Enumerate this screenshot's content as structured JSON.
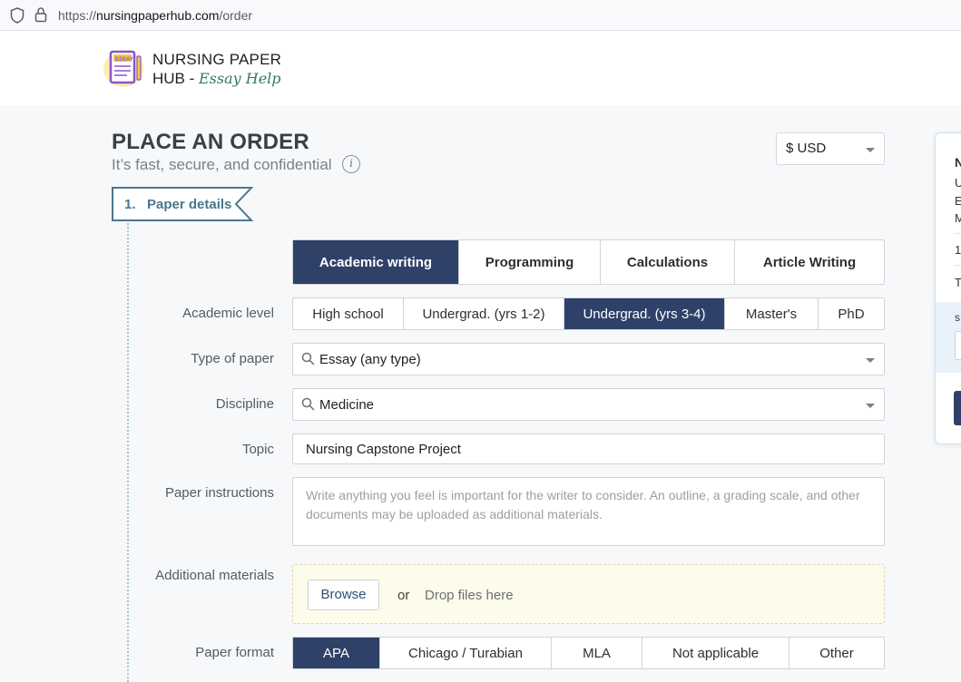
{
  "browser": {
    "url_prefix": "https://",
    "url_host": "nursingpaperhub.com",
    "url_path": "/order"
  },
  "brand": {
    "line1": "NURSING PAPER",
    "line2_prefix": "HUB - ",
    "line2_script": "Essay Help",
    "logo_text": "ESSAY"
  },
  "page": {
    "title": "PLACE AN ORDER",
    "subtitle": "It’s fast, secure, and confidential",
    "info_glyph": "i"
  },
  "currency": {
    "value": "$ USD"
  },
  "step": {
    "label": "1.   Paper details"
  },
  "side_panel": {
    "lines": [
      "N",
      "U",
      "E",
      "M",
      "1",
      "T",
      "s"
    ]
  },
  "service_tabs": [
    {
      "label": "Academic writing",
      "active": true
    },
    {
      "label": "Programming",
      "active": false
    },
    {
      "label": "Calculations",
      "active": false
    },
    {
      "label": "Article Writing",
      "active": false
    }
  ],
  "academic_level": {
    "label": "Academic level",
    "options": [
      {
        "label": "High school",
        "active": false
      },
      {
        "label": "Undergrad. (yrs 1-2)",
        "active": false
      },
      {
        "label": "Undergrad. (yrs 3-4)",
        "active": true
      },
      {
        "label": "Master's",
        "active": false
      },
      {
        "label": "PhD",
        "active": false
      }
    ]
  },
  "type_of_paper": {
    "label": "Type of paper",
    "value": "Essay (any type)"
  },
  "discipline": {
    "label": "Discipline",
    "value": "Medicine"
  },
  "topic": {
    "label": "Topic",
    "value": "Nursing Capstone Project"
  },
  "instructions": {
    "label": "Paper instructions",
    "placeholder": "Write anything you feel is important for the writer to consider. An outline, a grading scale, and other documents may be uploaded as additional materials."
  },
  "materials": {
    "label": "Additional materials",
    "browse": "Browse",
    "or": "or",
    "drop": "Drop files here"
  },
  "paper_format": {
    "label": "Paper format",
    "options": [
      {
        "label": "APA",
        "active": true
      },
      {
        "label": "Chicago / Turabian",
        "active": false
      },
      {
        "label": "MLA",
        "active": false
      },
      {
        "label": "Not applicable",
        "active": false
      },
      {
        "label": "Other",
        "active": false
      }
    ]
  },
  "colors": {
    "accent": "#2f4168",
    "step": "#4a7690",
    "dropzone": "#fdfbea"
  }
}
